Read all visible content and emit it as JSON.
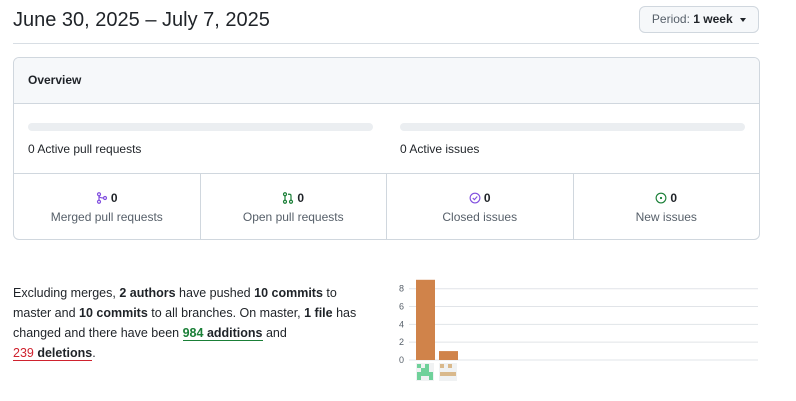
{
  "header": {
    "date_range": "June 30, 2025 – July 7, 2025",
    "period_label": "Period:",
    "period_value": "1 week"
  },
  "overview": {
    "title": "Overview",
    "active_pull_requests": {
      "count": "0",
      "label": "Active pull requests",
      "fill_fraction": 0
    },
    "active_issues": {
      "count": "0",
      "label": "Active issues",
      "fill_fraction": 0
    },
    "stats": [
      {
        "icon": "merged-pr-icon",
        "count": "0",
        "label": "Merged pull requests",
        "color": "#8250df"
      },
      {
        "icon": "open-pr-icon",
        "count": "0",
        "label": "Open pull requests",
        "color": "#1a7f37"
      },
      {
        "icon": "closed-issue-icon",
        "count": "0",
        "label": "Closed issues",
        "color": "#8250df"
      },
      {
        "icon": "open-issue-icon",
        "count": "0",
        "label": "New issues",
        "color": "#1a7f37"
      }
    ]
  },
  "summary": {
    "t1": "Excluding merges, ",
    "authors": "2 authors",
    "t2": " have pushed ",
    "commits": "10 commits",
    "t3": " to master and ",
    "commits_all": "10 commits",
    "t4": " to all branches. On master, ",
    "files": "1 file",
    "t5": " has changed and there have been ",
    "additions_num": "984",
    "additions_word": "additions",
    "t6": " and ",
    "deletions_num": "239",
    "deletions_word": "deletions",
    "t7": "."
  },
  "chart_data": {
    "type": "bar",
    "categories": [
      "author-1",
      "author-2"
    ],
    "values": [
      9,
      1
    ],
    "ylim": [
      0,
      9
    ],
    "yticks": [
      "0",
      "2",
      "4",
      "6",
      "8"
    ],
    "bar_color": "#d0834a",
    "avatar_icons": [
      "identicon-green-icon",
      "identicon-tan-icon"
    ],
    "avatar_colors": [
      "#6fd19a",
      "#d9b98c"
    ]
  }
}
